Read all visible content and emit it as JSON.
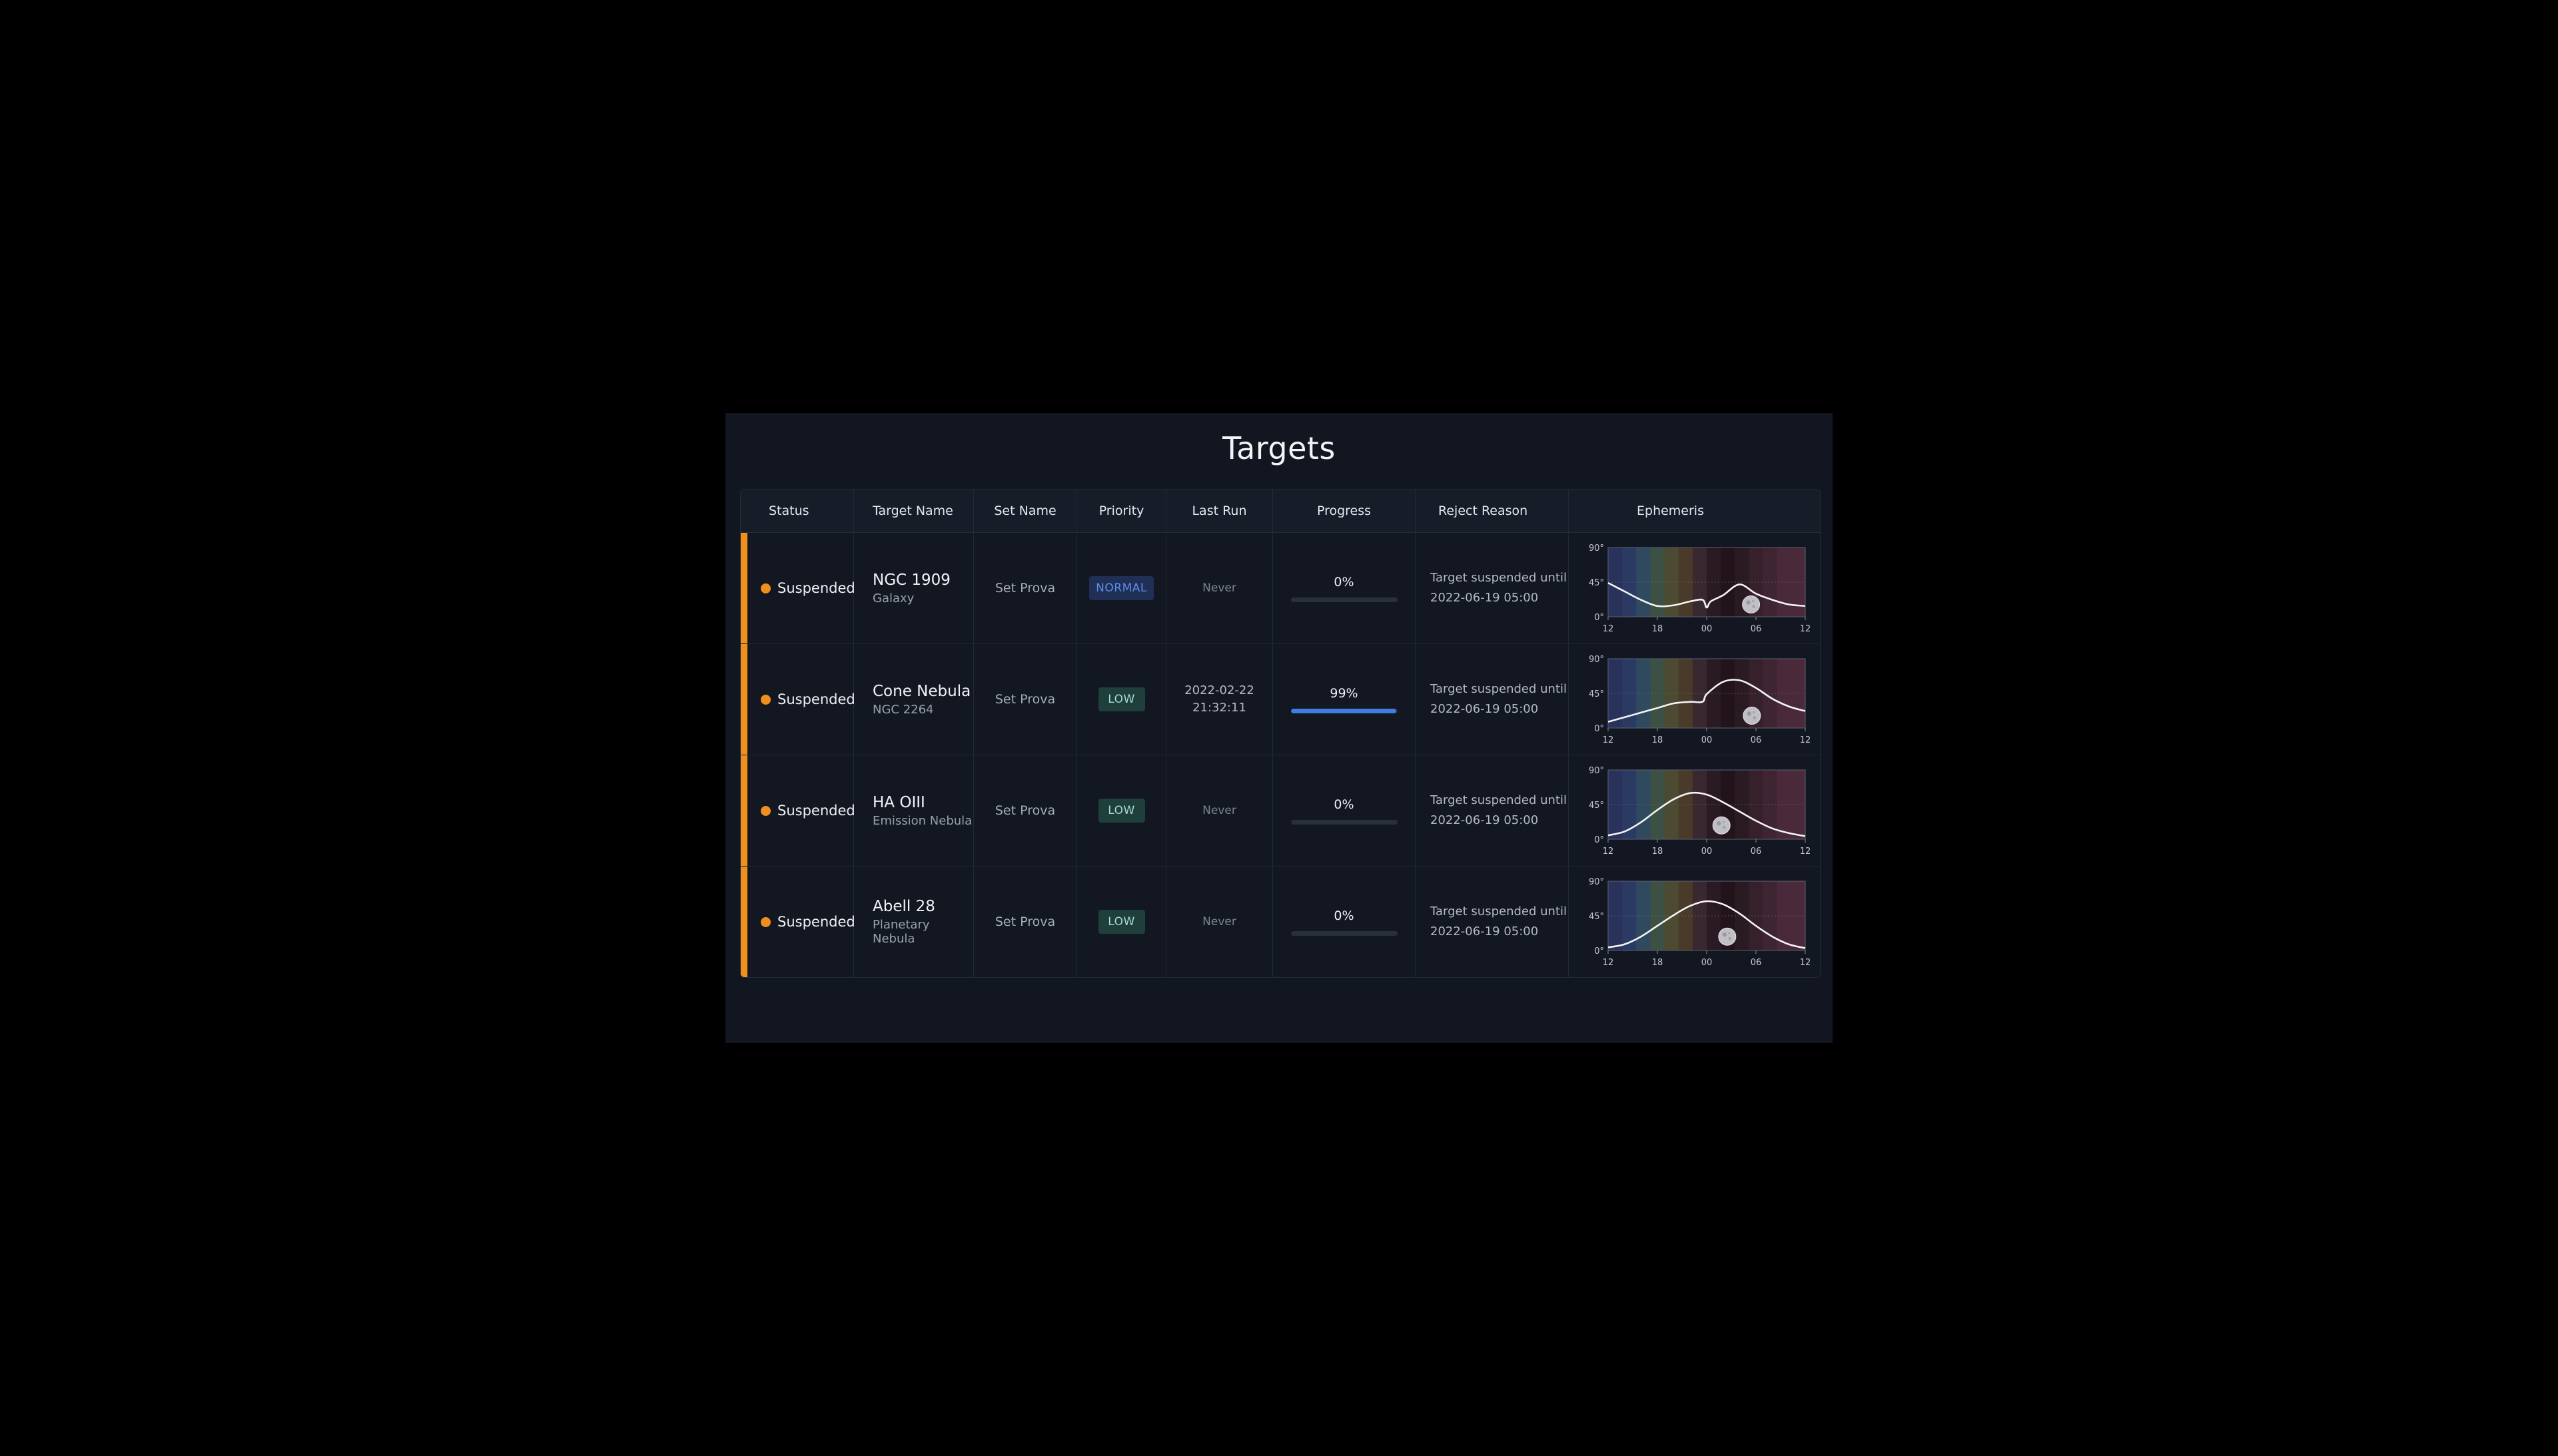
{
  "page": {
    "title": "Targets"
  },
  "colors": {
    "suspended": "#f0901c",
    "normal_badge_bg": "#1f2f55",
    "normal_badge_text": "#5f8fe8",
    "low_badge_bg": "#1f3f3d",
    "low_badge_text": "#a7dcd2",
    "progress_fill": "#3f7de0"
  },
  "columns": [
    "Status",
    "Target Name",
    "Set Name",
    "Priority",
    "Last Run",
    "Progress",
    "Reject Reason",
    "Ephemeris"
  ],
  "rows": [
    {
      "status": "Suspended",
      "name": "NGC 1909",
      "type": "Galaxy",
      "set": "Set Prova",
      "priority": "NORMAL",
      "last_run": [
        "Never"
      ],
      "progress_label": "0%",
      "progress": 0.0,
      "reject": [
        "Target suspended until",
        "2022-06-19 05:00"
      ]
    },
    {
      "status": "Suspended",
      "name": "Cone Nebula",
      "type": "NGC 2264",
      "set": "Set Prova",
      "priority": "LOW",
      "last_run": [
        "2022-02-22",
        "21:32:11"
      ],
      "progress_label": "99%",
      "progress": 0.99,
      "reject": [
        "Target suspended until",
        "2022-06-19 05:00"
      ]
    },
    {
      "status": "Suspended",
      "name": "HA OIII",
      "type": "Emission Nebula",
      "set": "Set Prova",
      "priority": "LOW",
      "last_run": [
        "Never"
      ],
      "progress_label": "0%",
      "progress": 0.0,
      "reject": [
        "Target suspended until",
        "2022-06-19 05:00"
      ]
    },
    {
      "status": "Suspended",
      "name": "Abell 28",
      "type": "Planetary Nebula",
      "set": "Set Prova",
      "priority": "LOW",
      "last_run": [
        "Never"
      ],
      "progress_label": "0%",
      "progress": 0.0,
      "reject": [
        "Target suspended until",
        "2022-06-19 05:00"
      ]
    }
  ],
  "chart_data": [
    {
      "type": "line",
      "x_ticks": [
        "12",
        "18",
        "00",
        "06",
        "12"
      ],
      "y_ticks": [
        "0°",
        "45°",
        "90°"
      ],
      "ylim": [
        0,
        90
      ],
      "x_hours": [
        0,
        2,
        4,
        6,
        8,
        10,
        11.5,
        12,
        12.5,
        14,
        16,
        18,
        20,
        22,
        24
      ],
      "altitude": [
        44,
        33,
        22,
        14,
        15,
        20,
        22,
        12,
        20,
        28,
        42,
        30,
        22,
        16,
        14
      ],
      "moon_hour": 17.4,
      "moon_alt": 16
    },
    {
      "type": "line",
      "x_hours": [
        0,
        2,
        4,
        6,
        8,
        10,
        11.5,
        12,
        14,
        16,
        18,
        20,
        22,
        24
      ],
      "altitude": [
        8,
        14,
        20,
        26,
        32,
        34,
        34,
        44,
        60,
        62,
        52,
        38,
        28,
        22
      ],
      "moon_hour": 17.5,
      "moon_alt": 16
    },
    {
      "type": "line",
      "x_hours": [
        0,
        2,
        4,
        6,
        8,
        10,
        12,
        14,
        16,
        18,
        20,
        22,
        24
      ],
      "altitude": [
        5,
        10,
        22,
        38,
        52,
        60,
        58,
        48,
        36,
        24,
        14,
        8,
        4
      ],
      "moon_hour": 13.8,
      "moon_alt": 18
    },
    {
      "type": "line",
      "x_hours": [
        0,
        2,
        4,
        6,
        8,
        10,
        12,
        14,
        16,
        18,
        20,
        22,
        24
      ],
      "altitude": [
        4,
        8,
        18,
        32,
        46,
        58,
        64,
        60,
        48,
        32,
        18,
        8,
        3
      ],
      "moon_hour": 14.5,
      "moon_alt": 18
    }
  ]
}
